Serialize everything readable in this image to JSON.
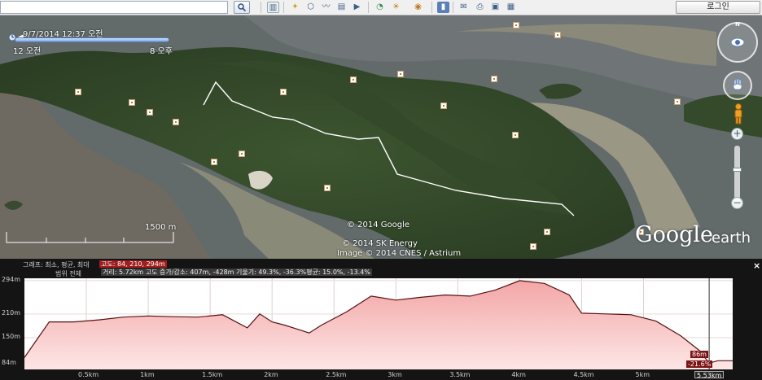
{
  "toolbar": {
    "search_value": "",
    "login_label": "로그인",
    "icons": [
      "sidebar-icon",
      "placemark-icon",
      "polygon-icon",
      "path-icon",
      "image-overlay-icon",
      "tour-icon",
      "historical-imagery-icon",
      "sunlight-icon",
      "planet-icon",
      "ruler-icon",
      "email-icon",
      "print-icon",
      "save-image-icon"
    ]
  },
  "map": {
    "time_slider": {
      "current": "9/7/2014  12:37 오전",
      "start": "12 오전",
      "end": "8 오후"
    },
    "scale_label": "1500 m",
    "copyright": [
      "© 2014 Google",
      "© 2014 SK Energy",
      "Image © 2014 CNES / Astrium"
    ],
    "logo_google": "Google",
    "logo_earth": "earth",
    "compass_label": "N"
  },
  "profile": {
    "graph_label": "그래프: 최소, 평균, 최대",
    "elevation_tag": "고도: 84, 210, 294m",
    "scope_label": "범위 전체",
    "stats": "거리: 5.72km 고도 증가/감소: 407m, -428m 기울기: 49.3%, -36.3%평균: 15.0%, -13.4%",
    "close_label": "×",
    "cursor_elev": "86m",
    "cursor_slope": "-21.6%",
    "cursor_dist": "5.53km",
    "colors": {
      "fill": "#f6b8b8",
      "line": "#5a1010",
      "cursor": "#7a1414"
    }
  },
  "chart_data": {
    "type": "area",
    "xlabel": "",
    "ylabel": "",
    "x_ticks": [
      "0.5km",
      "1km",
      "1.5km",
      "2km",
      "2.5km",
      "3km",
      "3.5km",
      "4km",
      "4.5km",
      "5km"
    ],
    "y_ticks": [
      "294m",
      "210m",
      "150m",
      "84m"
    ],
    "x": [
      0,
      0.2,
      0.4,
      0.6,
      0.8,
      1.0,
      1.2,
      1.4,
      1.6,
      1.8,
      1.9,
      2.0,
      2.1,
      2.2,
      2.3,
      2.4,
      2.6,
      2.8,
      3.0,
      3.2,
      3.4,
      3.6,
      3.8,
      4.0,
      4.2,
      4.4,
      4.5,
      4.7,
      4.9,
      5.1,
      5.3,
      5.45,
      5.53,
      5.6,
      5.72
    ],
    "y": [
      100,
      190,
      190,
      195,
      202,
      205,
      203,
      202,
      208,
      175,
      210,
      190,
      182,
      172,
      162,
      182,
      215,
      255,
      245,
      252,
      258,
      255,
      270,
      294,
      287,
      258,
      212,
      210,
      208,
      192,
      155,
      118,
      86,
      92,
      92
    ],
    "ylim": [
      70,
      300
    ],
    "xlim": [
      0,
      5.72
    ],
    "grid": true,
    "cursor_x": 5.53
  }
}
